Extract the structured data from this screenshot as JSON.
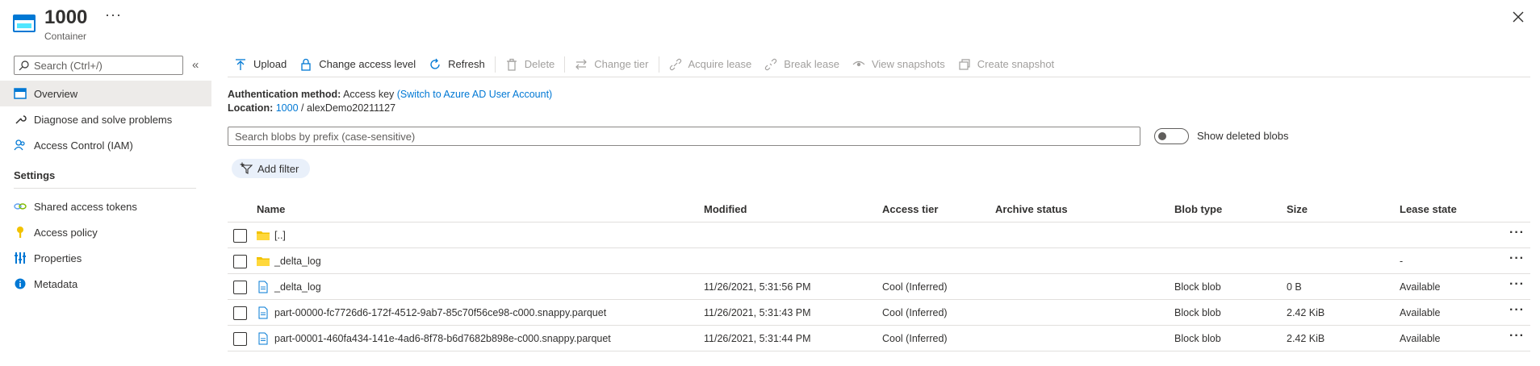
{
  "header": {
    "title": "1000",
    "subtitle": "Container",
    "more": "···",
    "icon": "container-icon",
    "close_icon": "close-icon"
  },
  "sidebar": {
    "search_placeholder": "Search (Ctrl+/)",
    "collapse": "«",
    "items": [
      {
        "label": "Overview",
        "icon": "overview-icon",
        "active": true
      },
      {
        "label": "Diagnose and solve problems",
        "icon": "wrench-icon"
      },
      {
        "label": "Access Control (IAM)",
        "icon": "people-icon"
      }
    ],
    "settings_section": "Settings",
    "settings_items": [
      {
        "label": "Shared access tokens",
        "icon": "link-icon"
      },
      {
        "label": "Access policy",
        "icon": "key-icon"
      },
      {
        "label": "Properties",
        "icon": "properties-icon"
      },
      {
        "label": "Metadata",
        "icon": "info-icon"
      }
    ]
  },
  "toolbar": {
    "upload": "Upload",
    "change_access": "Change access level",
    "refresh": "Refresh",
    "delete": "Delete",
    "change_tier": "Change tier",
    "acquire_lease": "Acquire lease",
    "break_lease": "Break lease",
    "view_snapshots": "View snapshots",
    "create_snapshot": "Create snapshot"
  },
  "info": {
    "auth_label": "Authentication method:",
    "auth_value": "Access key",
    "auth_link": "(Switch to Azure AD User Account)",
    "location_label": "Location:",
    "location_link": "1000",
    "location_sep": "/",
    "location_value": "alexDemo20211127"
  },
  "filters": {
    "search_placeholder": "Search blobs by prefix (case-sensitive)",
    "show_deleted_label": "Show deleted blobs",
    "show_deleted": false,
    "add_filter": "Add filter"
  },
  "table": {
    "columns": {
      "name": "Name",
      "modified": "Modified",
      "access_tier": "Access tier",
      "archive_status": "Archive status",
      "blob_type": "Blob type",
      "size": "Size",
      "lease_state": "Lease state"
    },
    "rows": [
      {
        "name": "[..]",
        "type_icon": "folder-icon",
        "modified": "",
        "access_tier": "",
        "archive_status": "",
        "blob_type": "",
        "size": "",
        "lease_state": "",
        "more": "···"
      },
      {
        "name": "_delta_log",
        "type_icon": "folder-icon",
        "modified": "",
        "access_tier": "",
        "archive_status": "",
        "blob_type": "",
        "size": "",
        "lease_state": "-",
        "more": "···"
      },
      {
        "name": "_delta_log",
        "type_icon": "file-icon",
        "modified": "11/26/2021, 5:31:56 PM",
        "access_tier": "Cool (Inferred)",
        "archive_status": "",
        "blob_type": "Block blob",
        "size": "0 B",
        "lease_state": "Available",
        "more": "···"
      },
      {
        "name": "part-00000-fc7726d6-172f-4512-9ab7-85c70f56ce98-c000.snappy.parquet",
        "type_icon": "file-icon",
        "modified": "11/26/2021, 5:31:43 PM",
        "access_tier": "Cool (Inferred)",
        "archive_status": "",
        "blob_type": "Block blob",
        "size": "2.42 KiB",
        "lease_state": "Available",
        "more": "···"
      },
      {
        "name": "part-00001-460fa434-141e-4ad6-8f78-b6d7682b898e-c000.snappy.parquet",
        "type_icon": "file-icon",
        "modified": "11/26/2021, 5:31:44 PM",
        "access_tier": "Cool (Inferred)",
        "archive_status": "",
        "blob_type": "Block blob",
        "size": "2.42 KiB",
        "lease_state": "Available",
        "more": "···"
      }
    ]
  },
  "colors": {
    "accent": "#0078d4",
    "folder": "#f2c200",
    "active_nav": "#edebe9"
  }
}
